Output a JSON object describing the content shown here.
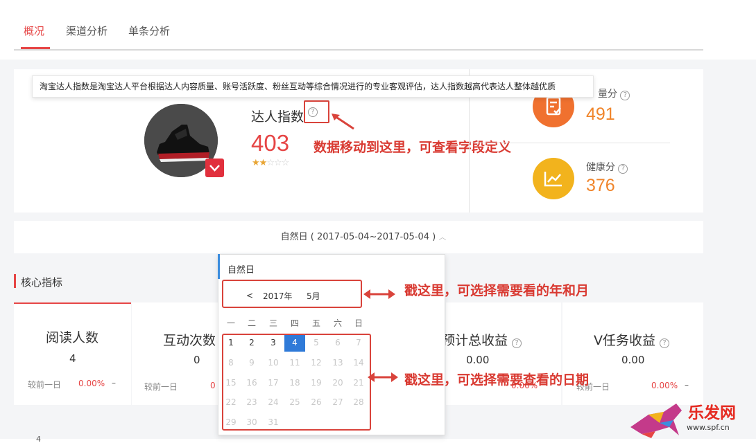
{
  "tabs": [
    {
      "label": "概况",
      "active": true
    },
    {
      "label": "渠道分析",
      "active": false
    },
    {
      "label": "单条分析",
      "active": false
    }
  ],
  "tooltip": "淘宝达人指数是淘宝达人平台根据达人内容质量、账号活跃度、粉丝互动等综合情况进行的专业客观评估，达人指数越高代表达人整体越优质",
  "talent_index": {
    "label": "达人指数",
    "value": "403",
    "stars_filled": 2,
    "stars_total": 5,
    "help_icon": "question-circle-icon"
  },
  "annotations": {
    "hover_help": "数据移动到这里，可查看字段定义",
    "year_month": "戳这里，可选择需要看的年和月",
    "dates": "戳这里，可选择需要查看的日期"
  },
  "side_scores": [
    {
      "label": "量分",
      "value": "491",
      "color": "#f0712f",
      "icon": "document-check-icon"
    },
    {
      "label": "健康分",
      "value": "376",
      "color": "#f2b31d",
      "icon": "trend-chart-icon"
    }
  ],
  "date_range": "自然日 ( 2017-05-04~2017-05-04 )",
  "core": {
    "title": "核心指标",
    "metrics": [
      {
        "title": "阅读人数",
        "value": "4",
        "compare_label": "较前一日",
        "pct": "0.00%",
        "dash": "–"
      },
      {
        "title": "互动次数",
        "value": "0",
        "compare_label": "较前一日",
        "pct": "0",
        "dash": ""
      },
      {
        "title": "预计总收益",
        "value": "0.00",
        "compare_label": "",
        "pct": "0.00%",
        "dash": ""
      },
      {
        "title": "V任务收益",
        "value": "0.00",
        "compare_label": "较前一日",
        "pct": "0.00%",
        "dash": "–"
      }
    ],
    "bottom_axis_value": "4"
  },
  "calendar": {
    "type_label": "自然日",
    "prev": "<",
    "year": "2017年",
    "month": "5月",
    "weekdays": [
      "一",
      "二",
      "三",
      "四",
      "五",
      "六",
      "日"
    ],
    "days": [
      "1",
      "2",
      "3",
      "4",
      "5",
      "6",
      "7",
      "8",
      "9",
      "10",
      "11",
      "12",
      "13",
      "14",
      "15",
      "16",
      "17",
      "18",
      "19",
      "20",
      "21",
      "22",
      "23",
      "24",
      "25",
      "26",
      "27",
      "28",
      "29",
      "30",
      "31"
    ],
    "enabled_through": 4,
    "selected": "4"
  },
  "watermark": {
    "text": "乐发网",
    "url": "www.spf.cn"
  }
}
